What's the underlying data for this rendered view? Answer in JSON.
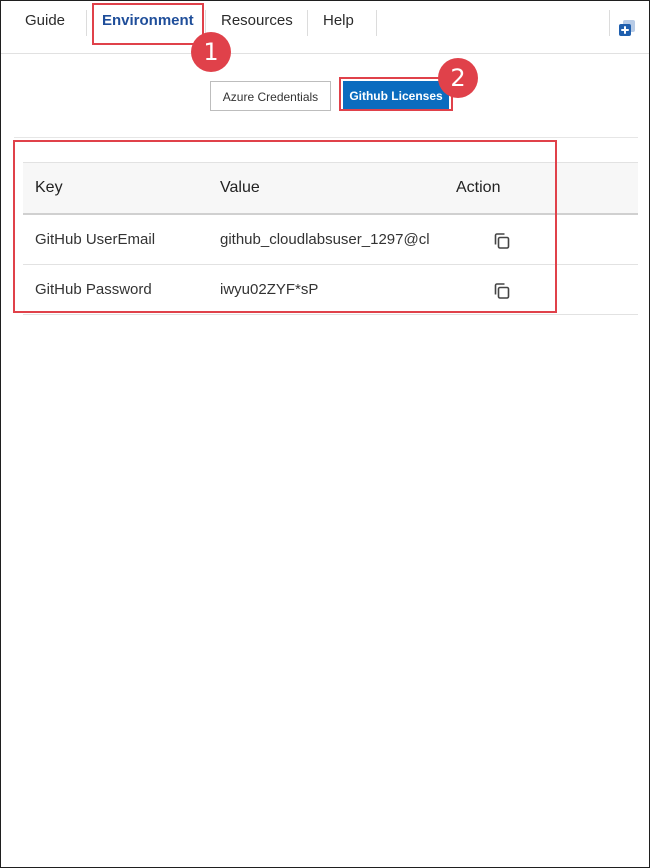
{
  "nav": {
    "tabs": [
      {
        "label": "Guide"
      },
      {
        "label": "Environment"
      },
      {
        "label": "Resources"
      },
      {
        "label": "Help"
      }
    ],
    "active": "Environment"
  },
  "subtabs": {
    "azure_label": "Azure Credentials",
    "github_label": "Github Licenses"
  },
  "table": {
    "headers": {
      "key": "Key",
      "value": "Value",
      "action": "Action"
    },
    "rows": [
      {
        "key": "GitHub UserEmail",
        "value": "github_cloudlabsuser_1297@cl"
      },
      {
        "key": "GitHub Password",
        "value": "iwyu02ZYF*sP"
      }
    ]
  },
  "annotations": {
    "badge1": "1",
    "badge2": "2"
  },
  "colors": {
    "accent": "#0b6cbf",
    "active_tab": "#1f4e9a",
    "highlight": "#e0414a"
  },
  "icons": {
    "expand": "expand-panel-icon",
    "copy": "copy-icon"
  }
}
